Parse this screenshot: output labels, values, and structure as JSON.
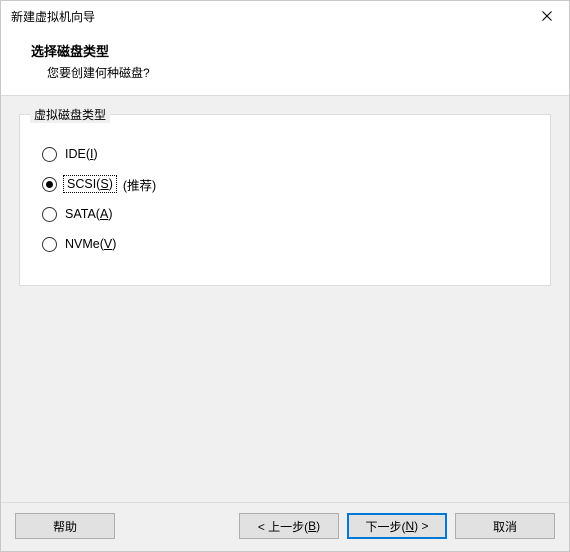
{
  "window": {
    "title": "新建虚拟机向导"
  },
  "header": {
    "heading": "选择磁盘类型",
    "subheading": "您要创建何种磁盘?"
  },
  "group": {
    "legend": "虚拟磁盘类型",
    "options": [
      {
        "pre": "IDE(",
        "mn": "I",
        "post": ")",
        "suffix": "",
        "checked": false,
        "focused": false
      },
      {
        "pre": "SCSI(",
        "mn": "S",
        "post": ")",
        "suffix": "(推荐)",
        "checked": true,
        "focused": true
      },
      {
        "pre": "SATA(",
        "mn": "A",
        "post": ")",
        "suffix": "",
        "checked": false,
        "focused": false
      },
      {
        "pre": "NVMe(",
        "mn": "V",
        "post": ")",
        "suffix": "",
        "checked": false,
        "focused": false
      }
    ]
  },
  "footer": {
    "help": {
      "pre": "帮助",
      "mn": "",
      "post": ""
    },
    "back": {
      "pre": "< 上一步(",
      "mn": "B",
      "post": ")"
    },
    "next": {
      "pre": "下一步(",
      "mn": "N",
      "post": ") >"
    },
    "cancel": {
      "pre": "取消",
      "mn": "",
      "post": ""
    }
  }
}
